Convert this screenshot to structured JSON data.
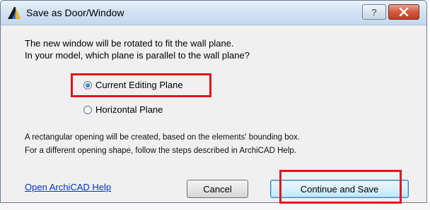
{
  "colors": {
    "highlight": "#e0141d",
    "link": "#0033cc",
    "titlebar": "#d4e3f3",
    "close_button": "#c33d25"
  },
  "window": {
    "title": "Save as Door/Window",
    "icon": "archicad-app-icon",
    "help_button_label": "?",
    "close_icon": "close-x-icon"
  },
  "intro": {
    "line1": "The new window will be rotated to fit the wall plane.",
    "line2": "In your model, which plane is parallel to the wall plane?"
  },
  "plane_options": [
    {
      "label": "Current Editing Plane",
      "selected": true
    },
    {
      "label": "Horizontal Plane",
      "selected": false
    }
  ],
  "note": {
    "line1": "A rectangular opening will be created, based on the elements' bounding box.",
    "line2": "For a different opening shape, follow the steps described in ArchiCAD Help."
  },
  "footer": {
    "help_link": "Open ArchiCAD Help",
    "cancel_label": "Cancel",
    "continue_label": "Continue and Save"
  }
}
